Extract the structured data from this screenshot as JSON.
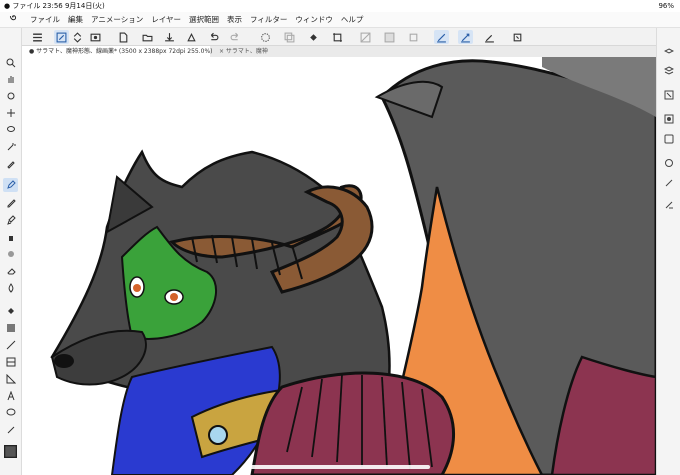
{
  "status": {
    "left": "● ファイル  23:56   9月14日(火)",
    "battery": "96%"
  },
  "menu": {
    "items": [
      "ファイル",
      "編集",
      "アニメーション",
      "レイヤー",
      "選択範囲",
      "表示",
      "フィルター",
      "ウィンドウ",
      "ヘルプ"
    ]
  },
  "tabs": {
    "active": "● サラマト、魔神形態、線画薬* (3500 x 2388px 72dpi 255.0%)",
    "inactive": "× サラマト、魔神"
  },
  "colors": {
    "accent": "#3a78c8",
    "toolbar_bg": "#f2f2f2",
    "fur_dark": "#4a4a4a",
    "fur_green": "#3aa23a",
    "fur_blue": "#2a3ad0",
    "horn": "#8a5a35",
    "wing_orange": "#ef8d45",
    "wing_gray": "#5a5a5a",
    "band_red": "#8c3450",
    "collar_gold": "#c9a440",
    "gem_blue": "#a9d6ee"
  },
  "left_tools": [
    "zoom-icon",
    "hand-icon",
    "rotate-icon",
    "move-icon",
    "lasso-icon",
    "magic-wand-icon",
    "eyedropper-icon",
    "pen-icon",
    "pencil-icon",
    "brush-icon",
    "airbrush-icon",
    "decoration-icon",
    "eraser-icon",
    "blend-icon",
    "fill-icon",
    "gradient-icon",
    "line-icon",
    "frame-icon",
    "ruler-icon",
    "text-icon",
    "balloon-icon",
    "correction-icon",
    "color-swatch-icon"
  ],
  "right_tools": [
    "layer-property-icon",
    "layer-icon",
    "navigator-icon",
    "sub-view-icon",
    "material-icon",
    "tool-property-icon",
    "brush-size-icon",
    "color-wheel-icon"
  ]
}
